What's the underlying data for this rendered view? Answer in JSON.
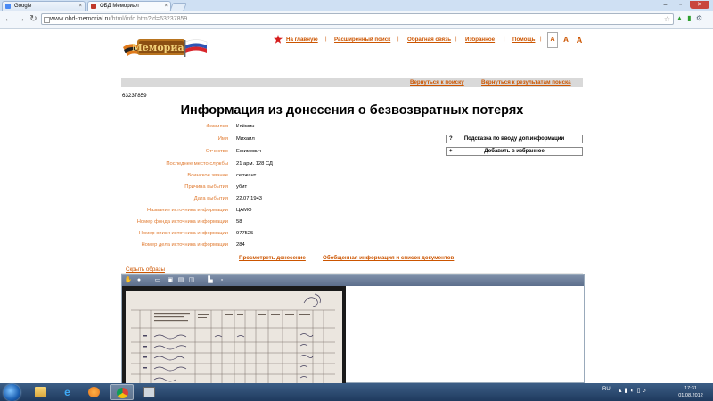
{
  "browser": {
    "tabs": [
      {
        "label": "Google",
        "favicon_color": "#4a8af4"
      },
      {
        "label": "ОБД Мемориал",
        "favicon_color": "#c0392b"
      }
    ],
    "url": {
      "host": "www.obd-memorial.ru",
      "path": "/html/info.htm?id=63237859"
    }
  },
  "nav": {
    "items": [
      "На главную",
      "Расширенный поиск",
      "Обратная связь",
      "Избранное",
      "Помощь"
    ],
    "font_sizes": [
      "A",
      "A",
      "A"
    ],
    "accent_color": "#cc5500"
  },
  "back_links": {
    "search": "Вернуться к поиску",
    "results": "Вернуться к результатам поиска"
  },
  "record": {
    "id": "63237859",
    "title": "Информация из донесения о безвозвратных потерях",
    "fields": [
      {
        "label": "Фамилия",
        "value": "Клёмин"
      },
      {
        "label": "Имя",
        "value": "Михаил"
      },
      {
        "label": "Отчество",
        "value": "Ефимович"
      },
      {
        "label": "Последнее место службы",
        "value": "21 арм. 128 СД"
      },
      {
        "label": "Воинское звание",
        "value": "сержант"
      },
      {
        "label": "Причина выбытия",
        "value": "убит"
      },
      {
        "label": "Дата выбытия",
        "value": "22.07.1943"
      },
      {
        "label": "Название источника информации",
        "value": "ЦАМО"
      },
      {
        "label": "Номер фонда источника информации",
        "value": "58"
      },
      {
        "label": "Номер описи источника информации",
        "value": "977525"
      },
      {
        "label": "Номер дела источника информации",
        "value": "284"
      }
    ]
  },
  "side_buttons": {
    "hint": {
      "icon": "?",
      "label": "Подсказка по вводу доп.информации"
    },
    "favorite": {
      "icon": "+",
      "label": "Добавить в избранное"
    }
  },
  "links": {
    "view_report": "Просмотреть донесение",
    "summary": "Обобщенная информация и список документов",
    "hide_images": "Скрыть образы"
  },
  "taskbar": {
    "lang": "RU",
    "time": "17:31",
    "date": "01.08.2012"
  }
}
